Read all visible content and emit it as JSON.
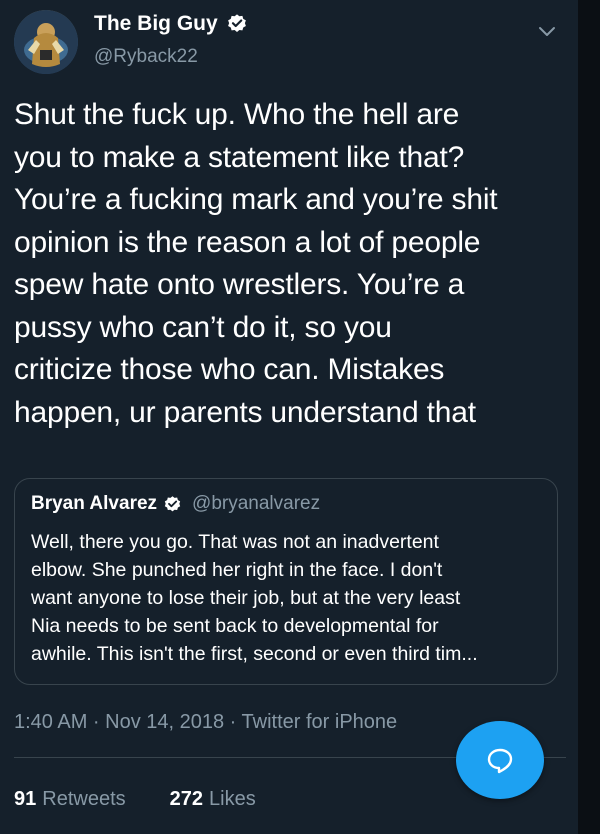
{
  "tweet": {
    "display_name": "The Big Guy",
    "handle": "@Ryback22",
    "text_lines": [
      "Shut the fuck up. Who the hell are",
      "you to make a statement like that?",
      "You’re a fucking mark and you’re shit",
      "opinion is the reason a lot of people",
      "spew hate onto wrestlers. You’re a",
      "pussy who can’t do it, so you",
      "criticize those who can. Mistakes",
      "happen, ur parents understand that"
    ],
    "timestamp": "1:40 AM · Nov 14, 2018 · Twitter for iPhone",
    "retweets_count": "91",
    "retweets_label": "Retweets",
    "likes_count": "272",
    "likes_label": "Likes"
  },
  "quote": {
    "display_name": "Bryan Alvarez",
    "handle": "@bryanalvarez",
    "text_lines": [
      "Well, there you go. That was not an inadvertent",
      "elbow. She punched her right in the face. I don't",
      "want anyone to lose their job, but at the very least",
      "Nia needs to be sent back to developmental for",
      "awhile. This isn't the first, second or even third tim..."
    ]
  },
  "icons": {
    "verified": "verified-badge-icon",
    "menu": "chevron-down-icon",
    "compose": "reply-bubble-icon"
  },
  "colors": {
    "background": "#15202b",
    "accent": "#1da1f2",
    "secondary_text": "#8899a6",
    "border": "#38444d"
  }
}
